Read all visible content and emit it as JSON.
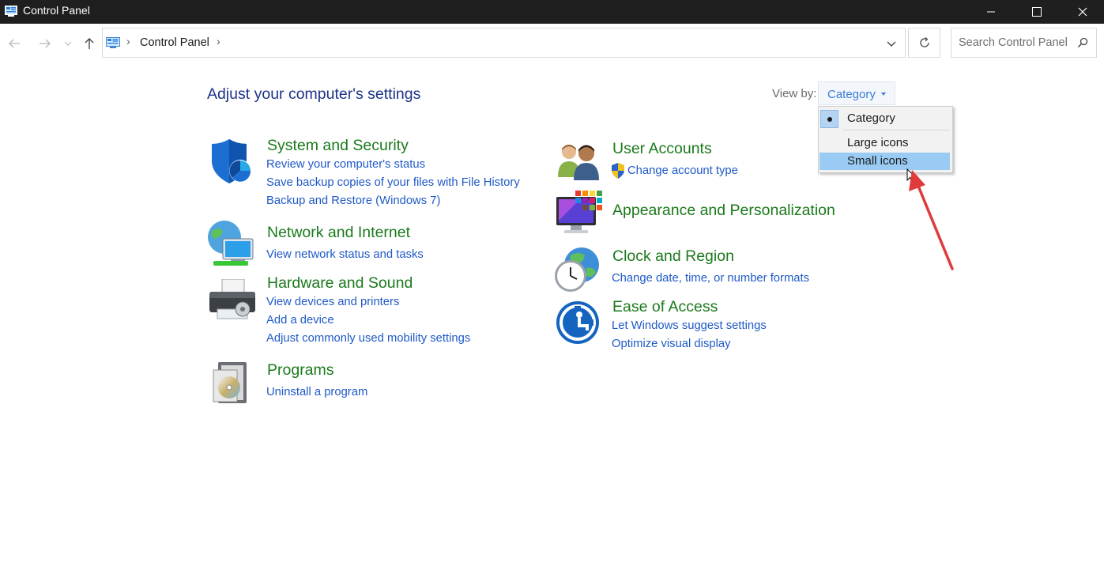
{
  "window": {
    "title": "Control Panel"
  },
  "nav": {
    "breadcrumb": "Control Panel",
    "search_placeholder": "Search Control Panel"
  },
  "main": {
    "title": "Adjust your computer's settings",
    "view_by_label": "View by:",
    "view_by_value": "Category",
    "view_menu": {
      "items": [
        "Category",
        "Large icons",
        "Small icons"
      ],
      "selected": "Category",
      "hovered": "Small icons"
    }
  },
  "categories": {
    "system_security": {
      "title": "System and Security",
      "icon": "shield-icon",
      "links": [
        "Review your computer's status",
        "Save backup copies of your files with File History",
        "Backup and Restore (Windows 7)"
      ]
    },
    "network": {
      "title": "Network and Internet",
      "icon": "network-globe-icon",
      "links": [
        "View network status and tasks"
      ]
    },
    "hardware": {
      "title": "Hardware and Sound",
      "icon": "printer-icon",
      "links": [
        "View devices and printers",
        "Add a device",
        "Adjust commonly used mobility settings"
      ]
    },
    "programs": {
      "title": "Programs",
      "icon": "programs-icon",
      "links": [
        "Uninstall a program"
      ]
    },
    "user_accounts": {
      "title": "User Accounts",
      "icon": "users-icon",
      "links": [
        "Change account type"
      ]
    },
    "appearance": {
      "title": "Appearance and Personalization",
      "icon": "monitor-palette-icon",
      "links": []
    },
    "clock": {
      "title": "Clock and Region",
      "icon": "clock-globe-icon",
      "links": [
        "Change date, time, or number formats"
      ]
    },
    "ease": {
      "title": "Ease of Access",
      "icon": "ease-of-access-icon",
      "links": [
        "Let Windows suggest settings",
        "Optimize visual display"
      ]
    }
  },
  "colors": {
    "titlebar": "#1f1f1f",
    "heading_green": "#1b7a1b",
    "link_blue": "#1f5ac7",
    "page_title_blue": "#1e3287",
    "menu_hover": "#99cbf5",
    "annotation_arrow": "#e03a3a"
  }
}
